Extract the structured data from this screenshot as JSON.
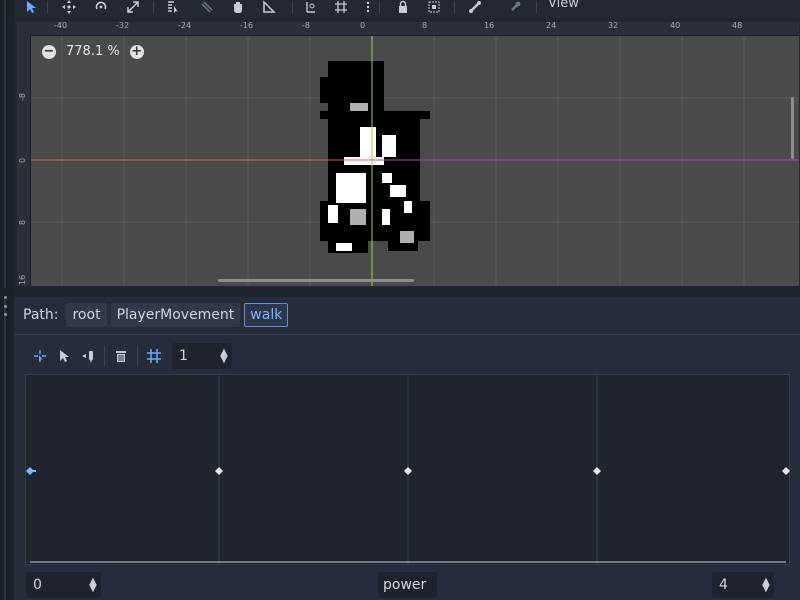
{
  "toolbar": {
    "view_menu_label": "View",
    "tools": [
      "select-icon",
      "move-icon",
      "rotate-icon",
      "scale-icon",
      "list-select-icon",
      "ruler-icon",
      "pan-icon",
      "measure-icon",
      "smart-snap-icon",
      "grid-snap-icon",
      "more-icon",
      "lock-icon",
      "group-icon",
      "bone-icon",
      "skeleton-icon"
    ]
  },
  "viewport": {
    "zoom_level": "778.1 %",
    "ruler_top_labels": [
      "-40",
      "-32",
      "-24",
      "-16",
      "-8",
      "0",
      "8",
      "16",
      "24",
      "32",
      "40",
      "48"
    ],
    "ruler_left_labels": [
      "-8",
      "0",
      "8",
      "16"
    ],
    "colors": {
      "x_axis": "#e05c5c",
      "y_axis": "#9fd33f",
      "background": "#4a4a4a"
    }
  },
  "path_bar": {
    "label": "Path:",
    "segments": [
      "root",
      "PlayerMovement",
      "walk"
    ]
  },
  "blend_toolbar": {
    "tools": [
      "create-point-icon",
      "select-point-icon",
      "create-triangle-icon",
      "delete-icon",
      "snap-icon"
    ],
    "snap_value": "1"
  },
  "blend_space": {
    "min_value": "0",
    "label_value": "power",
    "max_value": "4",
    "point_positions": [
      0,
      1,
      2,
      3,
      4
    ],
    "accent": "#7fb3ff"
  }
}
